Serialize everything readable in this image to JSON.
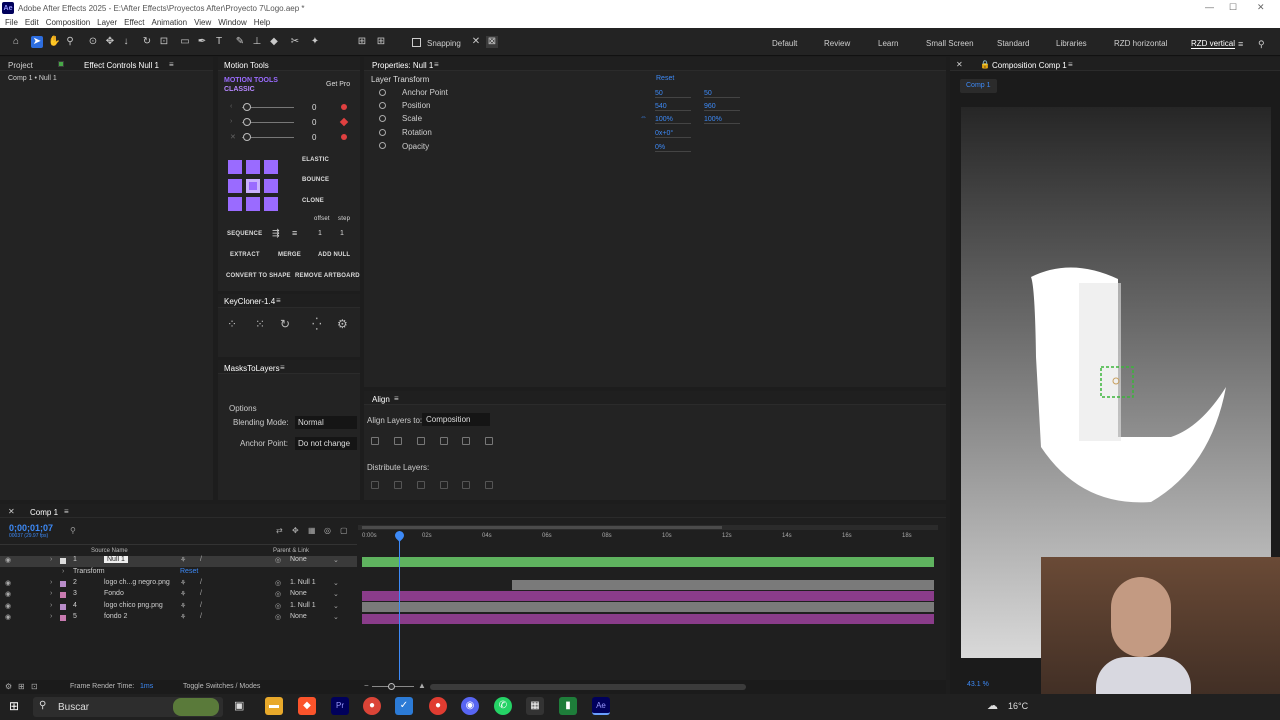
{
  "window": {
    "title": "Adobe After Effects 2025 - E:\\After Effects\\Proyectos After\\Proyecto 7\\Logo.aep *"
  },
  "menu": [
    "File",
    "Edit",
    "Composition",
    "Layer",
    "Effect",
    "Animation",
    "View",
    "Window",
    "Help"
  ],
  "toolbar": {
    "snapping": "Snapping",
    "workspaces": [
      "Default",
      "Review",
      "Learn",
      "Small Screen",
      "Standard",
      "Libraries",
      "RZD horizontal",
      "RZD vertical"
    ]
  },
  "project": {
    "tab": "Project",
    "effect_tab": "Effect Controls Null 1",
    "breadcrumb": "Comp 1 • Null 1"
  },
  "motion_tools": {
    "tab": "Motion Tools",
    "brand1": "MOTION TOOLS",
    "brand2": "CLASSIC",
    "get_pro": "Get Pro",
    "rows": [
      "0",
      "0",
      "0"
    ],
    "elastic": "ELASTIC",
    "bounce": "BOUNCE",
    "clone": "CLONE",
    "offset": "offset",
    "step": "step",
    "sequence": "SEQUENCE",
    "offset_val": "1",
    "step_val": "1",
    "extract": "EXTRACT",
    "merge": "MERGE",
    "add_null": "ADD NULL",
    "convert": "CONVERT TO SHAPE",
    "remove": "REMOVE ARTBOARD"
  },
  "keycloner": {
    "tab": "KeyCloner-1.4"
  },
  "masks": {
    "tab": "MasksToLayers",
    "options": "Options",
    "blend_label": "Blending Mode:",
    "blend_val": "Normal",
    "anchor_label": "Anchor Point:",
    "anchor_val": "Do not change"
  },
  "properties": {
    "tab": "Properties: Null 1",
    "section": "Layer Transform",
    "reset": "Reset",
    "items": [
      {
        "name": "Anchor Point",
        "v1": "50",
        "v2": "50"
      },
      {
        "name": "Position",
        "v1": "540",
        "v2": "960"
      },
      {
        "name": "Scale",
        "v1": "100%",
        "v2": "100%"
      },
      {
        "name": "Rotation",
        "v1": "0x+0°",
        "v2": ""
      },
      {
        "name": "Opacity",
        "v1": "0%",
        "v2": ""
      }
    ]
  },
  "align": {
    "tab": "Align",
    "align_to_label": "Align Layers to:",
    "align_to_val": "Composition",
    "distribute": "Distribute Layers:"
  },
  "composition": {
    "tab": "Composition Comp 1",
    "comp_chip": "Comp 1",
    "zoom": "43.1 %"
  },
  "timeline": {
    "tab": "Comp 1",
    "timecode": "0;00;01;07",
    "fps": "00037 (29.97 fps)",
    "col_source": "Source Name",
    "col_parent": "Parent & Link",
    "ticks": [
      "0:00s",
      "02s",
      "04s",
      "06s",
      "08s",
      "10s",
      "12s",
      "14s",
      "16s",
      "18s"
    ],
    "layers": [
      {
        "num": "1",
        "name": "Null 1",
        "parent": "None",
        "color": "#dddddd"
      },
      {
        "num": "2",
        "name": "logo ch...g negro.png",
        "parent": "1. Null 1",
        "color": "#b88cc8"
      },
      {
        "num": "3",
        "name": "Fondo",
        "parent": "None",
        "color": "#c87ab0"
      },
      {
        "num": "4",
        "name": "logo chico png.png",
        "parent": "1. Null 1",
        "color": "#b88cc8"
      },
      {
        "num": "5",
        "name": "fondo 2",
        "parent": "None",
        "color": "#c87ab0"
      }
    ],
    "transform": "Transform",
    "reset": "Reset",
    "render_time_label": "Frame Render Time:",
    "render_time": "1ms",
    "toggle": "Toggle Switches / Modes"
  },
  "taskbar": {
    "search": "Buscar",
    "temp": "16°C"
  },
  "colors": {
    "accent": "#2d6ee0",
    "timeline_green": "#5fb35f",
    "track_purple": "#8a3c8a",
    "mt_purple": "#9a6bff",
    "value_blue": "#3d8af7"
  }
}
